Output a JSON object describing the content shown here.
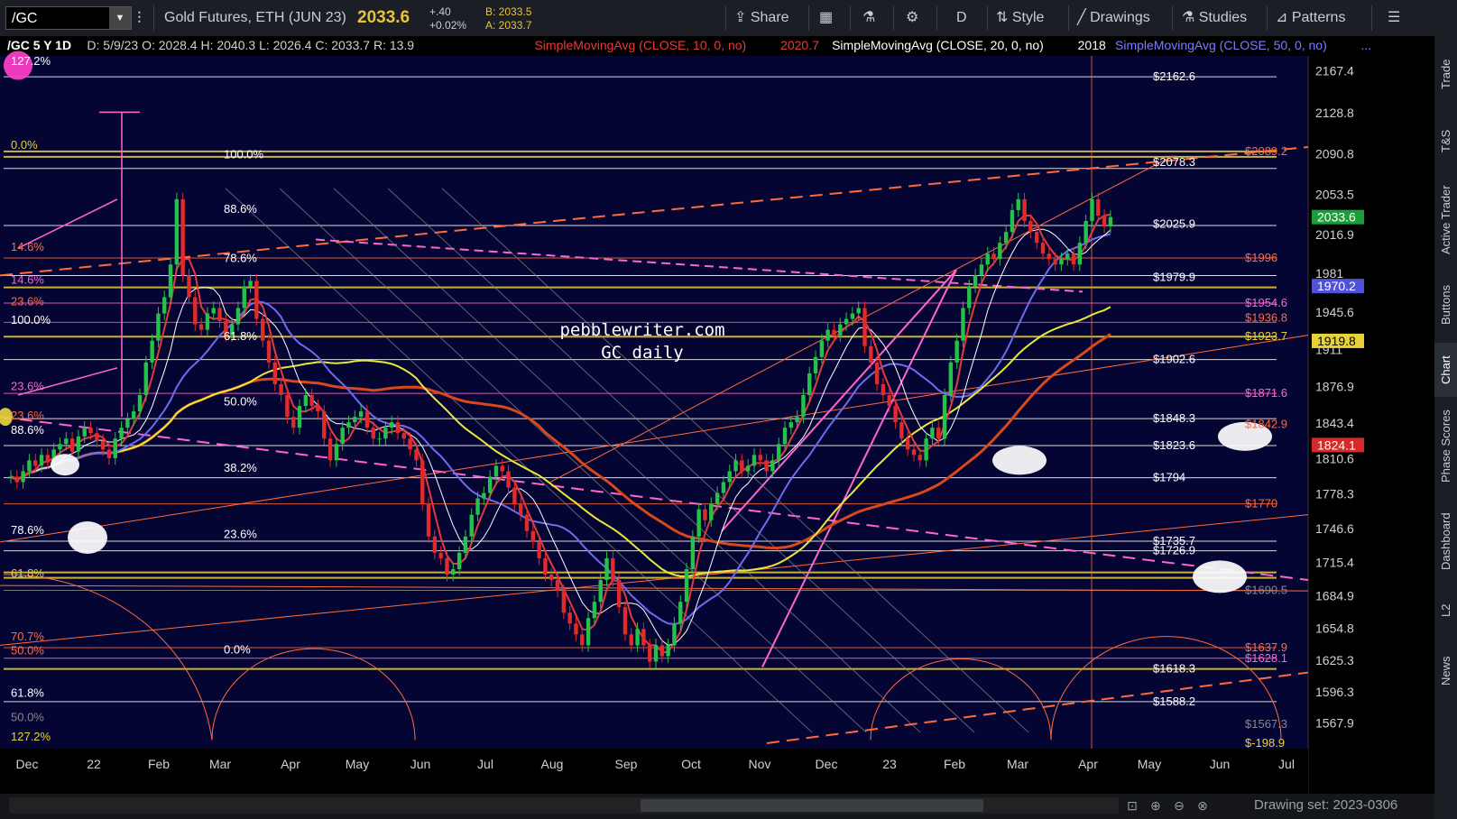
{
  "toolbar": {
    "symbol": "/GC",
    "description": "Gold Futures, ETH (JUN 23)",
    "last_price": "2033.6",
    "change": "+.40",
    "change_pct": "+0.02%",
    "bid": "B: 2033.5",
    "ask": "A: 2033.7",
    "share": "Share",
    "period": "D",
    "style": "Style",
    "drawings": "Drawings",
    "studies": "Studies",
    "patterns": "Patterns"
  },
  "side_tabs": [
    "Trade",
    "T&S",
    "Active Trader",
    "Buttons",
    "Chart",
    "Phase Scores",
    "Dashboard",
    "L2",
    "News"
  ],
  "bottom": {
    "drawing_set": "Drawing set: 2023-0306"
  },
  "chart_data": {
    "type": "candlestick",
    "header": "/GC 5 Y 1D",
    "ohlc_label": "D: 5/9/23  O: 2028.4  H: 2040.3  L: 2026.4  C: 2033.7  R: 13.9",
    "studies": [
      {
        "name": "SimpleMovingAvg (CLOSE, 10, 0, no)",
        "value": "2020.7",
        "color": "#e23b3b"
      },
      {
        "name": "SimpleMovingAvg (CLOSE, 20, 0, no)",
        "value": "2018",
        "color": "#ffffff"
      },
      {
        "name": "SimpleMovingAvg (CLOSE, 50, 0, no)",
        "value": "...",
        "color": "#7b7bff"
      }
    ],
    "annotation": [
      "pebblewriter.com",
      "GC daily"
    ],
    "x_labels": [
      "Dec",
      "22",
      "Feb",
      "Mar",
      "Apr",
      "May",
      "Jun",
      "Jul",
      "Aug",
      "Sep",
      "Oct",
      "Nov",
      "Dec",
      "23",
      "Feb",
      "Mar",
      "Apr",
      "May",
      "Jun",
      "Jul"
    ],
    "y_range": [
      1545,
      2195
    ],
    "y_ticks": [
      "2167.4",
      "2128.8",
      "2090.8",
      "2053.5",
      "2016.9",
      "1981",
      "1945.6",
      "1911",
      "1876.9",
      "1843.4",
      "1810.6",
      "1778.3",
      "1746.6",
      "1715.4",
      "1684.9",
      "1654.8",
      "1625.3",
      "1596.3",
      "1567.9"
    ],
    "price_flags": [
      {
        "label": "2033.6",
        "value": 2033.6,
        "bg": "#1a9e3a",
        "fg": "#ffffff"
      },
      {
        "label": "1970.2",
        "value": 1970.2,
        "bg": "#5252d8",
        "fg": "#ffffff"
      },
      {
        "label": "1919.8",
        "value": 1919.8,
        "bg": "#e8d23a",
        "fg": "#000000"
      },
      {
        "label": "1824.1",
        "value": 1824.1,
        "bg": "#d42a2a",
        "fg": "#ffffff"
      }
    ],
    "left_fib_labels": [
      {
        "label": "127.2%",
        "value": 2171,
        "color": "#ffffff"
      },
      {
        "label": "0.0%",
        "value": 2094,
        "color": "#e8d23a"
      },
      {
        "label": "14.6%",
        "value": 2000,
        "color": "#ff6b3d"
      },
      {
        "label": "14.6%",
        "value": 1970,
        "color": "#ff66cc"
      },
      {
        "label": "23.6%",
        "value": 1950,
        "color": "#ff6b3d"
      },
      {
        "label": "100.0%",
        "value": 1933,
        "color": "#ffffff"
      },
      {
        "label": "23.6%",
        "value": 1872,
        "color": "#ff66cc"
      },
      {
        "label": "23.6%",
        "value": 1845,
        "color": "#ff6b3d"
      },
      {
        "label": "88.6%",
        "value": 1832,
        "color": "#ffffff"
      },
      {
        "label": "78.6%",
        "value": 1740,
        "color": "#ffffff"
      },
      {
        "label": "61.8%",
        "value": 1700,
        "color": "#e8d23a"
      },
      {
        "label": "70.7%",
        "value": 1642,
        "color": "#ff6b3d"
      },
      {
        "label": "50.0%",
        "value": 1629,
        "color": "#ff6b3d"
      },
      {
        "label": "61.8%",
        "value": 1590,
        "color": "#ffffff"
      },
      {
        "label": "50.0%",
        "value": 1568,
        "color": "#888888"
      },
      {
        "label": "127.2%",
        "value": 1550,
        "color": "#e8d23a"
      }
    ],
    "mid_fib_labels": [
      {
        "label": "100.0%",
        "value": 2085
      },
      {
        "label": "88.6%",
        "value": 2035
      },
      {
        "label": "78.6%",
        "value": 1990
      },
      {
        "label": "61.8%",
        "value": 1918
      },
      {
        "label": "50.0%",
        "value": 1858
      },
      {
        "label": "38.2%",
        "value": 1797
      },
      {
        "label": "23.6%",
        "value": 1736
      },
      {
        "label": "0.0%",
        "value": 1630
      }
    ],
    "right_levels": [
      {
        "label": "$2162.6",
        "value": 2162.6,
        "color": "#ffffff"
      },
      {
        "label": "$2089.2",
        "value": 2094,
        "color": "#ff6b3d"
      },
      {
        "label": "$2078.3",
        "value": 2084,
        "color": "#ffffff"
      },
      {
        "label": "$2025.9",
        "value": 2027,
        "color": "#ffffff"
      },
      {
        "label": "$1996",
        "value": 1996,
        "color": "#ff6b3d"
      },
      {
        "label": "$1979.9",
        "value": 1978,
        "color": "#ffffff"
      },
      {
        "label": "$1954.6",
        "value": 1954.6,
        "color": "#ff66cc"
      },
      {
        "label": "$1936.8",
        "value": 1941,
        "color": "#ff6b3d"
      },
      {
        "label": "$1923.7",
        "value": 1923.7,
        "color": "#e8d23a"
      },
      {
        "label": "$1902.6",
        "value": 1902.6,
        "color": "#ffffff"
      },
      {
        "label": "$1871.6",
        "value": 1871.6,
        "color": "#ff66cc"
      },
      {
        "label": "$1848.3",
        "value": 1848.3,
        "color": "#ffffff"
      },
      {
        "label": "$1842.9",
        "value": 1842.9,
        "color": "#ff6b3d"
      },
      {
        "label": "$1823.6",
        "value": 1823.6,
        "color": "#ffffff"
      },
      {
        "label": "$1794",
        "value": 1794,
        "color": "#ffffff"
      },
      {
        "label": "$1770",
        "value": 1770,
        "color": "#ff6b3d"
      },
      {
        "label": "$1735.7",
        "value": 1735.7,
        "color": "#ffffff"
      },
      {
        "label": "$1726.9",
        "value": 1726.9,
        "color": "#ffffff"
      },
      {
        "label": "$1690.5",
        "value": 1690.5,
        "color": "#888888"
      },
      {
        "label": "$1637.9",
        "value": 1637.9,
        "color": "#ff6b3d"
      },
      {
        "label": "$1628.1",
        "value": 1628.1,
        "color": "#ff66cc"
      },
      {
        "label": "$1618.3",
        "value": 1618.3,
        "color": "#ffffff"
      },
      {
        "label": "$1588.2",
        "value": 1588.2,
        "color": "#ffffff"
      },
      {
        "label": "$1567.3",
        "value": 1567.3,
        "color": "#888888"
      },
      {
        "label": "$-198.9",
        "value": 1550,
        "color": "#e8d23a"
      }
    ],
    "hlines": [
      {
        "value": 2162.6,
        "color": "#ffffff"
      },
      {
        "value": 2094,
        "color": "#e8d23a"
      },
      {
        "value": 2089,
        "color": "#e8d23a"
      },
      {
        "value": 2078.3,
        "color": "#ffffff"
      },
      {
        "value": 2025.9,
        "color": "#ffffff"
      },
      {
        "value": 1996,
        "color": "#ff6b3d"
      },
      {
        "value": 1979.9,
        "color": "#ffffff"
      },
      {
        "value": 1969,
        "color": "#e8d23a"
      },
      {
        "value": 1954.6,
        "color": "#ff66cc"
      },
      {
        "value": 1936.8,
        "color": "#ff6b3d"
      },
      {
        "value": 1923.7,
        "color": "#e8d23a"
      },
      {
        "value": 1902.6,
        "color": "#ffffff"
      },
      {
        "value": 1871.6,
        "color": "#ff66cc"
      },
      {
        "value": 1848.3,
        "color": "#ffffff"
      },
      {
        "value": 1823.6,
        "color": "#ffffff"
      },
      {
        "value": 1794,
        "color": "#ffffff"
      },
      {
        "value": 1770,
        "color": "#ff6b3d"
      },
      {
        "value": 1735.7,
        "color": "#ffffff"
      },
      {
        "value": 1726.9,
        "color": "#ffffff"
      },
      {
        "value": 1707,
        "color": "#e8d23a"
      },
      {
        "value": 1702,
        "color": "#e8d23a"
      },
      {
        "value": 1690.5,
        "color": "#888888"
      },
      {
        "value": 1637.9,
        "color": "#ff6b3d"
      },
      {
        "value": 1628.1,
        "color": "#ff66cc"
      },
      {
        "value": 1618.3,
        "color": "#e8d23a"
      },
      {
        "value": 1588.2,
        "color": "#ffffff"
      }
    ],
    "closes": [
      1795,
      1790,
      1800,
      1810,
      1805,
      1815,
      1808,
      1820,
      1825,
      1830,
      1818,
      1832,
      1840,
      1835,
      1828,
      1820,
      1812,
      1830,
      1840,
      1848,
      1855,
      1870,
      1900,
      1920,
      1945,
      1960,
      1990,
      2050,
      1980,
      1960,
      1935,
      1930,
      1945,
      1950,
      1938,
      1925,
      1935,
      1950,
      1970,
      1975,
      1940,
      1920,
      1900,
      1880,
      1870,
      1850,
      1840,
      1860,
      1870,
      1860,
      1855,
      1830,
      1810,
      1825,
      1840,
      1845,
      1850,
      1855,
      1840,
      1830,
      1830,
      1840,
      1845,
      1835,
      1830,
      1820,
      1810,
      1770,
      1740,
      1725,
      1720,
      1705,
      1710,
      1725,
      1740,
      1760,
      1775,
      1780,
      1795,
      1805,
      1800,
      1785,
      1770,
      1760,
      1745,
      1735,
      1720,
      1705,
      1700,
      1690,
      1670,
      1660,
      1650,
      1640,
      1665,
      1680,
      1700,
      1720,
      1700,
      1675,
      1650,
      1640,
      1655,
      1640,
      1625,
      1640,
      1630,
      1640,
      1660,
      1680,
      1710,
      1740,
      1765,
      1755,
      1770,
      1780,
      1790,
      1800,
      1810,
      1800,
      1805,
      1815,
      1810,
      1800,
      1810,
      1825,
      1840,
      1845,
      1850,
      1870,
      1890,
      1905,
      1920,
      1930,
      1925,
      1935,
      1940,
      1945,
      1950,
      1915,
      1900,
      1880,
      1870,
      1860,
      1845,
      1830,
      1820,
      1815,
      1810,
      1830,
      1840,
      1830,
      1870,
      1900,
      1920,
      1950,
      1970,
      1980,
      1990,
      2000,
      1995,
      2010,
      2020,
      2040,
      2050,
      2030,
      2020,
      2010,
      2000,
      1995,
      1990,
      1995,
      2000,
      1990,
      2010,
      2030,
      2050,
      2035,
      2025,
      2033.6
    ]
  }
}
